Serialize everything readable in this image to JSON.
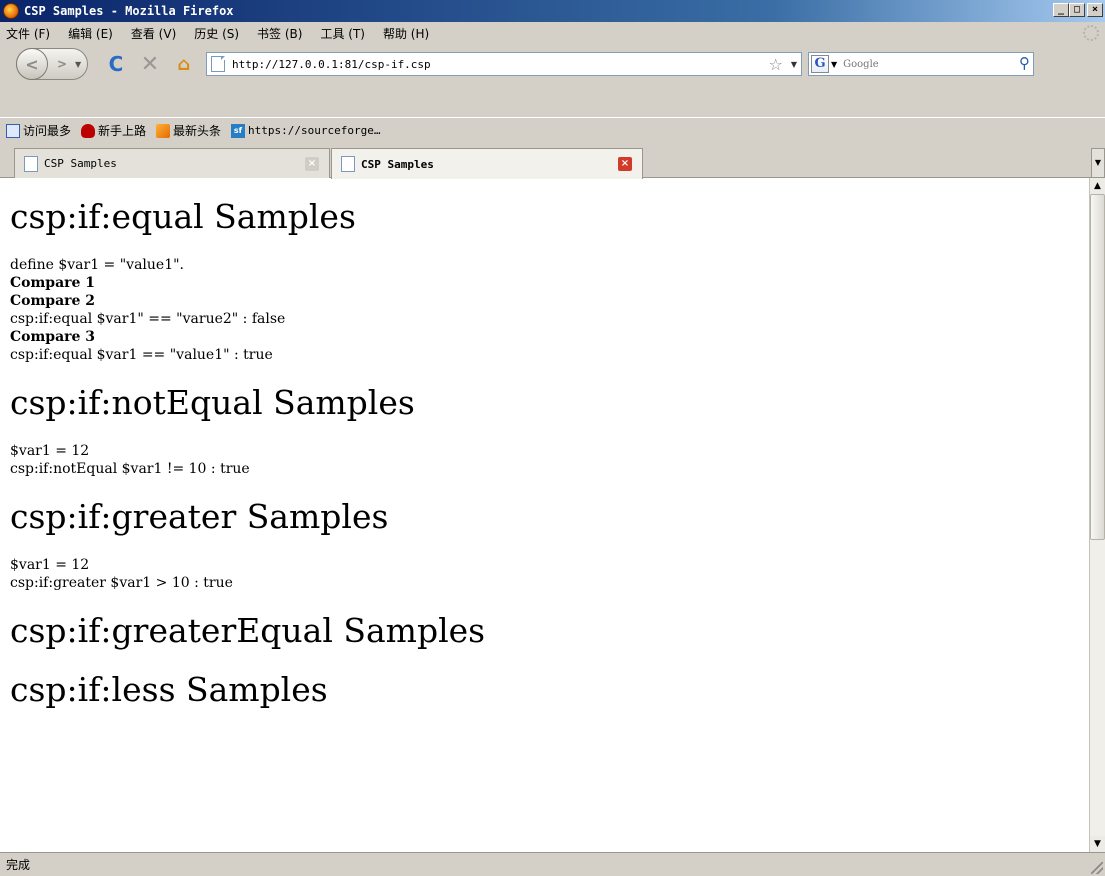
{
  "window": {
    "title": "CSP Samples - Mozilla Firefox",
    "buttons": {
      "minimize": "_",
      "maximize": "□",
      "close": "×"
    }
  },
  "menubar": {
    "items": [
      {
        "label": "文件 (F)"
      },
      {
        "label": "编辑 (E)"
      },
      {
        "label": "查看 (V)"
      },
      {
        "label": "历史 (S)"
      },
      {
        "label": "书签 (B)"
      },
      {
        "label": "工具 (T)"
      },
      {
        "label": "帮助 (H)"
      }
    ]
  },
  "navbar": {
    "url": "http://127.0.0.1:81/csp-if.csp",
    "search_placeholder": "Google"
  },
  "bookmarks": {
    "items": [
      {
        "label": "访问最多",
        "icon": "search-icon"
      },
      {
        "label": "新手上路",
        "icon": "bull-icon"
      },
      {
        "label": "最新头条",
        "icon": "rss-icon"
      },
      {
        "label": "https://sourceforge…",
        "icon": "sourceforge-icon"
      }
    ]
  },
  "tabs": [
    {
      "title": "CSP Samples",
      "active": false
    },
    {
      "title": "CSP Samples",
      "active": true
    }
  ],
  "content": {
    "sections": [
      {
        "heading": "csp:if:equal Samples",
        "lines": [
          {
            "text": "define $var1 = \"value1\".",
            "bold": false
          },
          {
            "text": "Compare 1",
            "bold": true
          },
          {
            "text": "Compare 2",
            "bold": true
          },
          {
            "text": "csp:if:equal $var1\" == \"varue2\" : false",
            "bold": false
          },
          {
            "text": "Compare 3",
            "bold": true
          },
          {
            "text": "csp:if:equal $var1 == \"value1\" : true",
            "bold": false
          }
        ]
      },
      {
        "heading": "csp:if:notEqual Samples",
        "lines": [
          {
            "text": "$var1 = 12",
            "bold": false
          },
          {
            "text": "csp:if:notEqual $var1 != 10 : true",
            "bold": false
          }
        ]
      },
      {
        "heading": "csp:if:greater Samples",
        "lines": [
          {
            "text": "$var1 = 12",
            "bold": false
          },
          {
            "text": "csp:if:greater $var1 > 10 : true",
            "bold": false
          }
        ]
      },
      {
        "heading": "csp:if:greaterEqual Samples",
        "lines": []
      },
      {
        "heading": "csp:if:less Samples",
        "lines": []
      }
    ]
  },
  "statusbar": {
    "text": "完成"
  }
}
